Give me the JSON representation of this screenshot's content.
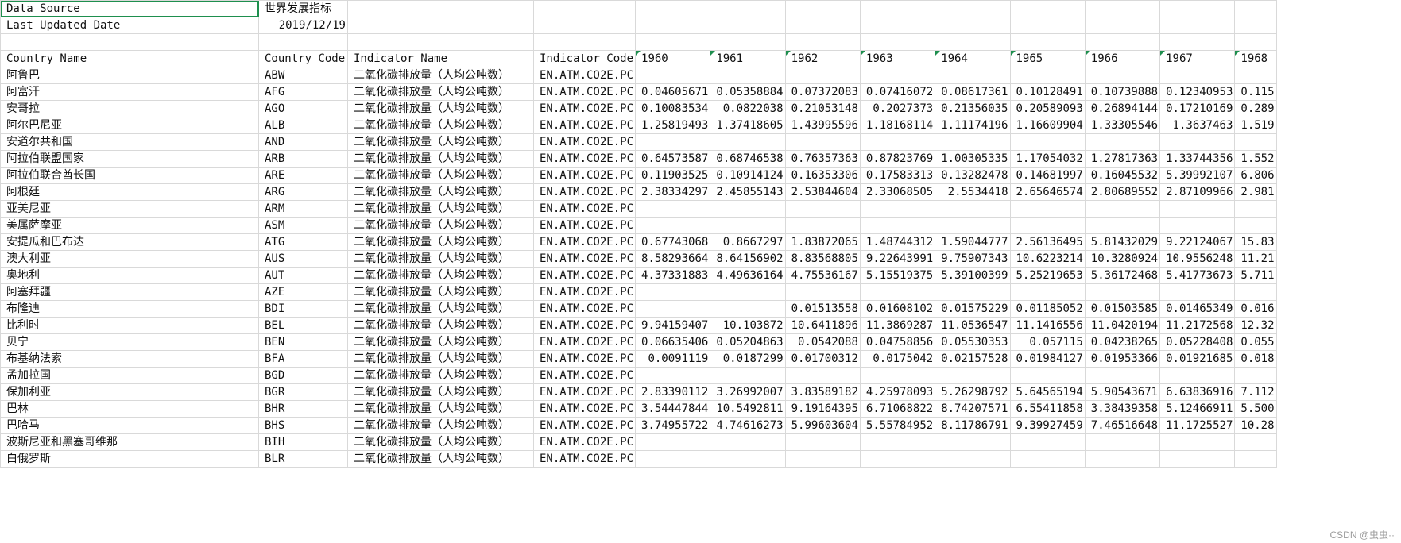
{
  "meta": {
    "source_label": "Data Source",
    "source_value": "世界发展指标",
    "updated_label": "Last Updated Date",
    "updated_value": "2019/12/19"
  },
  "headers": [
    "Country Name",
    "Country Code",
    "Indicator Name",
    "Indicator Code",
    "1960",
    "1961",
    "1962",
    "1963",
    "1964",
    "1965",
    "1966",
    "1967",
    "1968"
  ],
  "rows": [
    [
      "阿鲁巴",
      "ABW",
      "二氧化碳排放量（人均公吨数）",
      "EN.ATM.CO2E.PC",
      "",
      "",
      "",
      "",
      "",
      "",
      "",
      "",
      ""
    ],
    [
      "阿富汗",
      "AFG",
      "二氧化碳排放量（人均公吨数）",
      "EN.ATM.CO2E.PC",
      "0.04605671",
      "0.05358884",
      "0.07372083",
      "0.07416072",
      "0.08617361",
      "0.10128491",
      "0.10739888",
      "0.12340953",
      "0.115"
    ],
    [
      "安哥拉",
      "AGO",
      "二氧化碳排放量（人均公吨数）",
      "EN.ATM.CO2E.PC",
      "0.10083534",
      "0.0822038",
      "0.21053148",
      "0.2027373",
      "0.21356035",
      "0.20589093",
      "0.26894144",
      "0.17210169",
      "0.289"
    ],
    [
      "阿尔巴尼亚",
      "ALB",
      "二氧化碳排放量（人均公吨数）",
      "EN.ATM.CO2E.PC",
      "1.25819493",
      "1.37418605",
      "1.43995596",
      "1.18168114",
      "1.11174196",
      "1.16609904",
      "1.33305546",
      "1.3637463",
      "1.519"
    ],
    [
      "安道尔共和国",
      "AND",
      "二氧化碳排放量（人均公吨数）",
      "EN.ATM.CO2E.PC",
      "",
      "",
      "",
      "",
      "",
      "",
      "",
      "",
      ""
    ],
    [
      "阿拉伯联盟国家",
      "ARB",
      "二氧化碳排放量（人均公吨数）",
      "EN.ATM.CO2E.PC",
      "0.64573587",
      "0.68746538",
      "0.76357363",
      "0.87823769",
      "1.00305335",
      "1.17054032",
      "1.27817363",
      "1.33744356",
      "1.552"
    ],
    [
      "阿拉伯联合酋长国",
      "ARE",
      "二氧化碳排放量（人均公吨数）",
      "EN.ATM.CO2E.PC",
      "0.11903525",
      "0.10914124",
      "0.16353306",
      "0.17583313",
      "0.13282478",
      "0.14681997",
      "0.16045532",
      "5.39992107",
      "6.806"
    ],
    [
      "阿根廷",
      "ARG",
      "二氧化碳排放量（人均公吨数）",
      "EN.ATM.CO2E.PC",
      "2.38334297",
      "2.45855143",
      "2.53844604",
      "2.33068505",
      "2.5534418",
      "2.65646574",
      "2.80689552",
      "2.87109966",
      "2.981"
    ],
    [
      "亚美尼亚",
      "ARM",
      "二氧化碳排放量（人均公吨数）",
      "EN.ATM.CO2E.PC",
      "",
      "",
      "",
      "",
      "",
      "",
      "",
      "",
      ""
    ],
    [
      "美属萨摩亚",
      "ASM",
      "二氧化碳排放量（人均公吨数）",
      "EN.ATM.CO2E.PC",
      "",
      "",
      "",
      "",
      "",
      "",
      "",
      "",
      ""
    ],
    [
      "安提瓜和巴布达",
      "ATG",
      "二氧化碳排放量（人均公吨数）",
      "EN.ATM.CO2E.PC",
      "0.67743068",
      "0.8667297",
      "1.83872065",
      "1.48744312",
      "1.59044777",
      "2.56136495",
      "5.81432029",
      "9.22124067",
      "15.83"
    ],
    [
      "澳大利亚",
      "AUS",
      "二氧化碳排放量（人均公吨数）",
      "EN.ATM.CO2E.PC",
      "8.58293664",
      "8.64156902",
      "8.83568805",
      "9.22643991",
      "9.75907343",
      "10.6223214",
      "10.3280924",
      "10.9556248",
      "11.21"
    ],
    [
      "奥地利",
      "AUT",
      "二氧化碳排放量（人均公吨数）",
      "EN.ATM.CO2E.PC",
      "4.37331883",
      "4.49636164",
      "4.75536167",
      "5.15519375",
      "5.39100399",
      "5.25219653",
      "5.36172468",
      "5.41773673",
      "5.711"
    ],
    [
      "阿塞拜疆",
      "AZE",
      "二氧化碳排放量（人均公吨数）",
      "EN.ATM.CO2E.PC",
      "",
      "",
      "",
      "",
      "",
      "",
      "",
      "",
      ""
    ],
    [
      "布隆迪",
      "BDI",
      "二氧化碳排放量（人均公吨数）",
      "EN.ATM.CO2E.PC",
      "",
      "",
      "0.01513558",
      "0.01608102",
      "0.01575229",
      "0.01185052",
      "0.01503585",
      "0.01465349",
      "0.016"
    ],
    [
      "比利时",
      "BEL",
      "二氧化碳排放量（人均公吨数）",
      "EN.ATM.CO2E.PC",
      "9.94159407",
      "10.103872",
      "10.6411896",
      "11.3869287",
      "11.0536547",
      "11.1416556",
      "11.0420194",
      "11.2172568",
      "12.32"
    ],
    [
      "贝宁",
      "BEN",
      "二氧化碳排放量（人均公吨数）",
      "EN.ATM.CO2E.PC",
      "0.06635406",
      "0.05204863",
      "0.0542088",
      "0.04758856",
      "0.05530353",
      "0.057115",
      "0.04238265",
      "0.05228408",
      "0.055"
    ],
    [
      "布基纳法索",
      "BFA",
      "二氧化碳排放量（人均公吨数）",
      "EN.ATM.CO2E.PC",
      "0.0091119",
      "0.0187299",
      "0.01700312",
      "0.0175042",
      "0.02157528",
      "0.01984127",
      "0.01953366",
      "0.01921685",
      "0.018"
    ],
    [
      "孟加拉国",
      "BGD",
      "二氧化碳排放量（人均公吨数）",
      "EN.ATM.CO2E.PC",
      "",
      "",
      "",
      "",
      "",
      "",
      "",
      "",
      ""
    ],
    [
      "保加利亚",
      "BGR",
      "二氧化碳排放量（人均公吨数）",
      "EN.ATM.CO2E.PC",
      "2.83390112",
      "3.26992007",
      "3.83589182",
      "4.25978093",
      "5.26298792",
      "5.64565194",
      "5.90543671",
      "6.63836916",
      "7.112"
    ],
    [
      "巴林",
      "BHR",
      "二氧化碳排放量（人均公吨数）",
      "EN.ATM.CO2E.PC",
      "3.54447844",
      "10.5492811",
      "9.19164395",
      "6.71068822",
      "8.74207571",
      "6.55411858",
      "3.38439358",
      "5.12466911",
      "5.500"
    ],
    [
      "巴哈马",
      "BHS",
      "二氧化碳排放量（人均公吨数）",
      "EN.ATM.CO2E.PC",
      "3.74955722",
      "4.74616273",
      "5.99603604",
      "5.55784952",
      "8.11786791",
      "9.39927459",
      "7.46516648",
      "11.1725527",
      "10.28"
    ],
    [
      "波斯尼亚和黑塞哥维那",
      "BIH",
      "二氧化碳排放量（人均公吨数）",
      "EN.ATM.CO2E.PC",
      "",
      "",
      "",
      "",
      "",
      "",
      "",
      "",
      ""
    ],
    [
      "白俄罗斯",
      "BLR",
      "二氧化碳排放量（人均公吨数）",
      "EN.ATM.CO2E.PC",
      "",
      "",
      "",
      "",
      "",
      "",
      "",
      "",
      ""
    ]
  ],
  "watermark": "CSDN @虫虫··"
}
